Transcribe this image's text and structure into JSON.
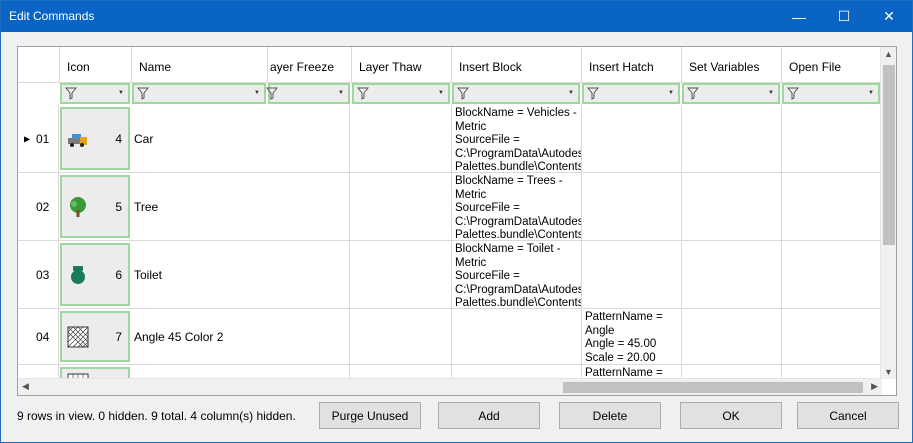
{
  "window": {
    "title": "Edit Commands",
    "min_glyph": "—",
    "max_glyph": "☐",
    "close_glyph": "✕"
  },
  "grid": {
    "columns": [
      {
        "label": ""
      },
      {
        "label": "Icon"
      },
      {
        "label": "Name"
      },
      {
        "label": "ayer Freeze"
      },
      {
        "label": "Layer Thaw"
      },
      {
        "label": "Insert Block"
      },
      {
        "label": "Insert Hatch"
      },
      {
        "label": "Set Variables"
      },
      {
        "label": "Open File"
      }
    ],
    "rows": [
      {
        "num": "01",
        "current": true,
        "icon": "car-icon",
        "icon_num": "4",
        "name": "Car",
        "insert_block": "BlockName = Vehicles -\nMetric\nSourceFile =\nC:\\ProgramData\\Autodesk\nPalettes.bundle\\Contents\\",
        "insert_hatch": ""
      },
      {
        "num": "02",
        "current": false,
        "icon": "tree-icon",
        "icon_num": "5",
        "name": "Tree",
        "insert_block": "BlockName = Trees -\nMetric\nSourceFile =\nC:\\ProgramData\\Autodesk\nPalettes.bundle\\Contents\\",
        "insert_hatch": ""
      },
      {
        "num": "03",
        "current": false,
        "icon": "toilet-icon",
        "icon_num": "6",
        "name": "Toilet",
        "insert_block": "BlockName = Toilet -\nMetric\nSourceFile =\nC:\\ProgramData\\Autodesk\nPalettes.bundle\\Contents\\",
        "insert_hatch": ""
      },
      {
        "num": "04",
        "current": false,
        "icon": "hatch-icon",
        "icon_num": "7",
        "name": "Angle 45 Color 2",
        "insert_block": "",
        "insert_hatch": "PatternName =\nAngle\nAngle = 45.00\nScale = 20.00"
      },
      {
        "num": "",
        "current": false,
        "icon": "grid-hatch-icon",
        "icon_num": "",
        "name": "",
        "insert_block": "",
        "insert_hatch": "PatternName ="
      }
    ]
  },
  "status_text": "9 rows in view. 0 hidden. 9 total. 4 column(s) hidden.",
  "buttons": {
    "purge": "Purge Unused",
    "add": "Add",
    "delete": "Delete",
    "ok": "OK",
    "cancel": "Cancel"
  },
  "colors": {
    "titlebar": "#0a64c4",
    "filter_border": "#9fd79f"
  }
}
